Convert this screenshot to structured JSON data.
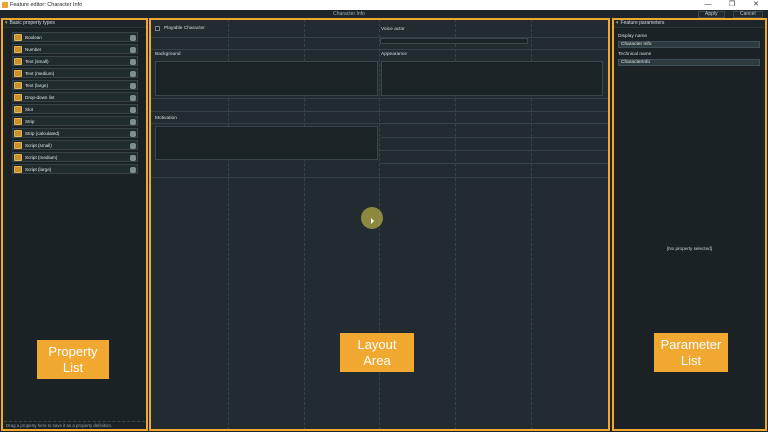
{
  "window": {
    "title": "Feature editor: Character Info",
    "controls": {
      "minimize": "—",
      "maximize": "❐",
      "close": "✕"
    }
  },
  "header": {
    "doc_title": "Character Info",
    "apply_label": "Apply",
    "cancel_label": "Cancel"
  },
  "left_panel": {
    "heading": "Basic property types",
    "items": [
      {
        "label": "Boolean"
      },
      {
        "label": "Number"
      },
      {
        "label": "Text (small)"
      },
      {
        "label": "Text (medium)"
      },
      {
        "label": "Text (large)"
      },
      {
        "label": "Drop-down list"
      },
      {
        "label": "Slot"
      },
      {
        "label": "Strip"
      },
      {
        "label": "Strip (calculated)"
      },
      {
        "label": "Script (small)"
      },
      {
        "label": "Script (medium)"
      },
      {
        "label": "Script (large)"
      }
    ],
    "drop_hint": "Drag a property here to save it as a property definition."
  },
  "layout_area": {
    "playable_label": "Playable Character",
    "voice_actor_label": "Voice actor",
    "background_label": "Background",
    "appearance_label": "Appearance",
    "motivation_label": "Motivation"
  },
  "right_panel": {
    "heading": "Feature parameters",
    "display_name_label": "Display name",
    "display_name_value": "Character Info",
    "technical_name_label": "Technical name",
    "technical_name_value": "CharacterInfo",
    "empty_text": "[No property selected]"
  },
  "callouts": {
    "property_list": "Property\nList",
    "layout_area": "Layout\nArea",
    "parameter_list": "Parameter\nList"
  },
  "colors": {
    "accent": "#f0a830",
    "panel_bg": "#1a2225",
    "layout_bg": "#222c30"
  }
}
